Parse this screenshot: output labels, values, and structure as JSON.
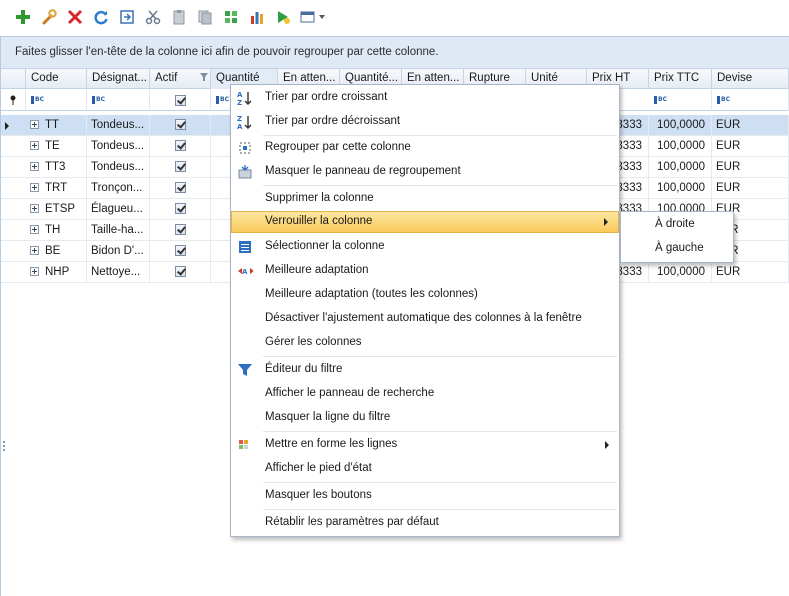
{
  "toolbar": {
    "buttons": [
      {
        "name": "add-icon",
        "color": "#2e9a2e"
      },
      {
        "name": "edit-wrench-icon",
        "color": "#d9962b"
      },
      {
        "name": "delete-icon",
        "color": "#d8262b"
      },
      {
        "name": "refresh-icon",
        "color": "#2f7ccf"
      },
      {
        "name": "export-icon",
        "color": "#3a72b7"
      },
      {
        "name": "cut-icon",
        "color": "#7a8797"
      },
      {
        "name": "paste-icon",
        "color": "#a0a7b0"
      },
      {
        "name": "copy-icon",
        "color": "#8d96a1"
      },
      {
        "name": "puzzle-icon",
        "color": "#38a14b"
      },
      {
        "name": "chart-icon",
        "color": "#d23b2c"
      },
      {
        "name": "run-icon",
        "color": "#2ea043"
      },
      {
        "name": "settings-dropdown-icon",
        "color": "#4a6e9c"
      }
    ]
  },
  "group_panel": {
    "text": "Faites glisser l'en-tête de la colonne ici afin de pouvoir regrouper par cette colonne."
  },
  "columns": [
    {
      "label": "Code"
    },
    {
      "label": "Désignat..."
    },
    {
      "label": "Actif"
    },
    {
      "label": "Quantité"
    },
    {
      "label": "En atten..."
    },
    {
      "label": "Quantité..."
    },
    {
      "label": "En atten..."
    },
    {
      "label": "Rupture"
    },
    {
      "label": "Unité"
    },
    {
      "label": "Prix HT"
    },
    {
      "label": "Prix TTC"
    },
    {
      "label": "Devise"
    }
  ],
  "rows": [
    {
      "code": "TT",
      "designation": "Tondeus...",
      "prix_ht": "3333",
      "prix_ttc": "100,0000",
      "devise": "EUR"
    },
    {
      "code": "TE",
      "designation": "Tondeus...",
      "prix_ht": "3333",
      "prix_ttc": "100,0000",
      "devise": "EUR"
    },
    {
      "code": "TT3",
      "designation": "Tondeus...",
      "prix_ht": "3333",
      "prix_ttc": "100,0000",
      "devise": "EUR"
    },
    {
      "code": "TRT",
      "designation": "Tronçon...",
      "prix_ht": "3333",
      "prix_ttc": "100,0000",
      "devise": "EUR"
    },
    {
      "code": "ETSP",
      "designation": "Élagueu...",
      "prix_ht": "3333",
      "prix_ttc": "100,0000",
      "devise": "EUR"
    },
    {
      "code": "TH",
      "designation": "Taille-ha...",
      "prix_ht": "",
      "prix_ttc": "",
      "devise": "UR"
    },
    {
      "code": "BE",
      "designation": "Bidon D'...",
      "prix_ht": "",
      "prix_ttc": "",
      "devise": "UR"
    },
    {
      "code": "NHP",
      "designation": "Nettoye...",
      "prix_ht": "3333",
      "prix_ttc": "100,0000",
      "devise": "EUR"
    }
  ],
  "context_menu": {
    "items": [
      {
        "label": "Trier par ordre croissant",
        "icon": "sort-ascending-icon"
      },
      {
        "label": "Trier par ordre décroissant",
        "icon": "sort-descending-icon"
      },
      {
        "label": "Regrouper par cette colonne",
        "icon": "group-by-icon"
      },
      {
        "label": "Masquer le panneau de regroupement",
        "icon": "hide-group-panel-icon"
      },
      {
        "label": "Supprimer la colonne",
        "icon": ""
      },
      {
        "label": "Verrouiller la colonne",
        "icon": "",
        "submenu": true
      },
      {
        "label": "Sélectionner la colonne",
        "icon": "select-column-icon"
      },
      {
        "label": "Meilleure adaptation",
        "icon": "best-fit-icon"
      },
      {
        "label": "Meilleure adaptation (toutes les colonnes)",
        "icon": ""
      },
      {
        "label": "Désactiver l'ajustement automatique des colonnes à la fenêtre",
        "icon": ""
      },
      {
        "label": "Gérer les colonnes",
        "icon": ""
      },
      {
        "label": "Éditeur du filtre",
        "icon": "filter-icon"
      },
      {
        "label": "Afficher le panneau de recherche",
        "icon": ""
      },
      {
        "label": "Masquer la ligne du filtre",
        "icon": ""
      },
      {
        "label": "Mettre en forme les lignes",
        "icon": "format-rows-icon",
        "submenu": true
      },
      {
        "label": "Afficher le pied d'état",
        "icon": ""
      },
      {
        "label": "Masquer les boutons",
        "icon": ""
      },
      {
        "label": "Rétablir les paramètres par défaut",
        "icon": ""
      }
    ]
  },
  "submenu": {
    "items": [
      {
        "label": "À droite"
      },
      {
        "label": "À gauche"
      }
    ]
  }
}
